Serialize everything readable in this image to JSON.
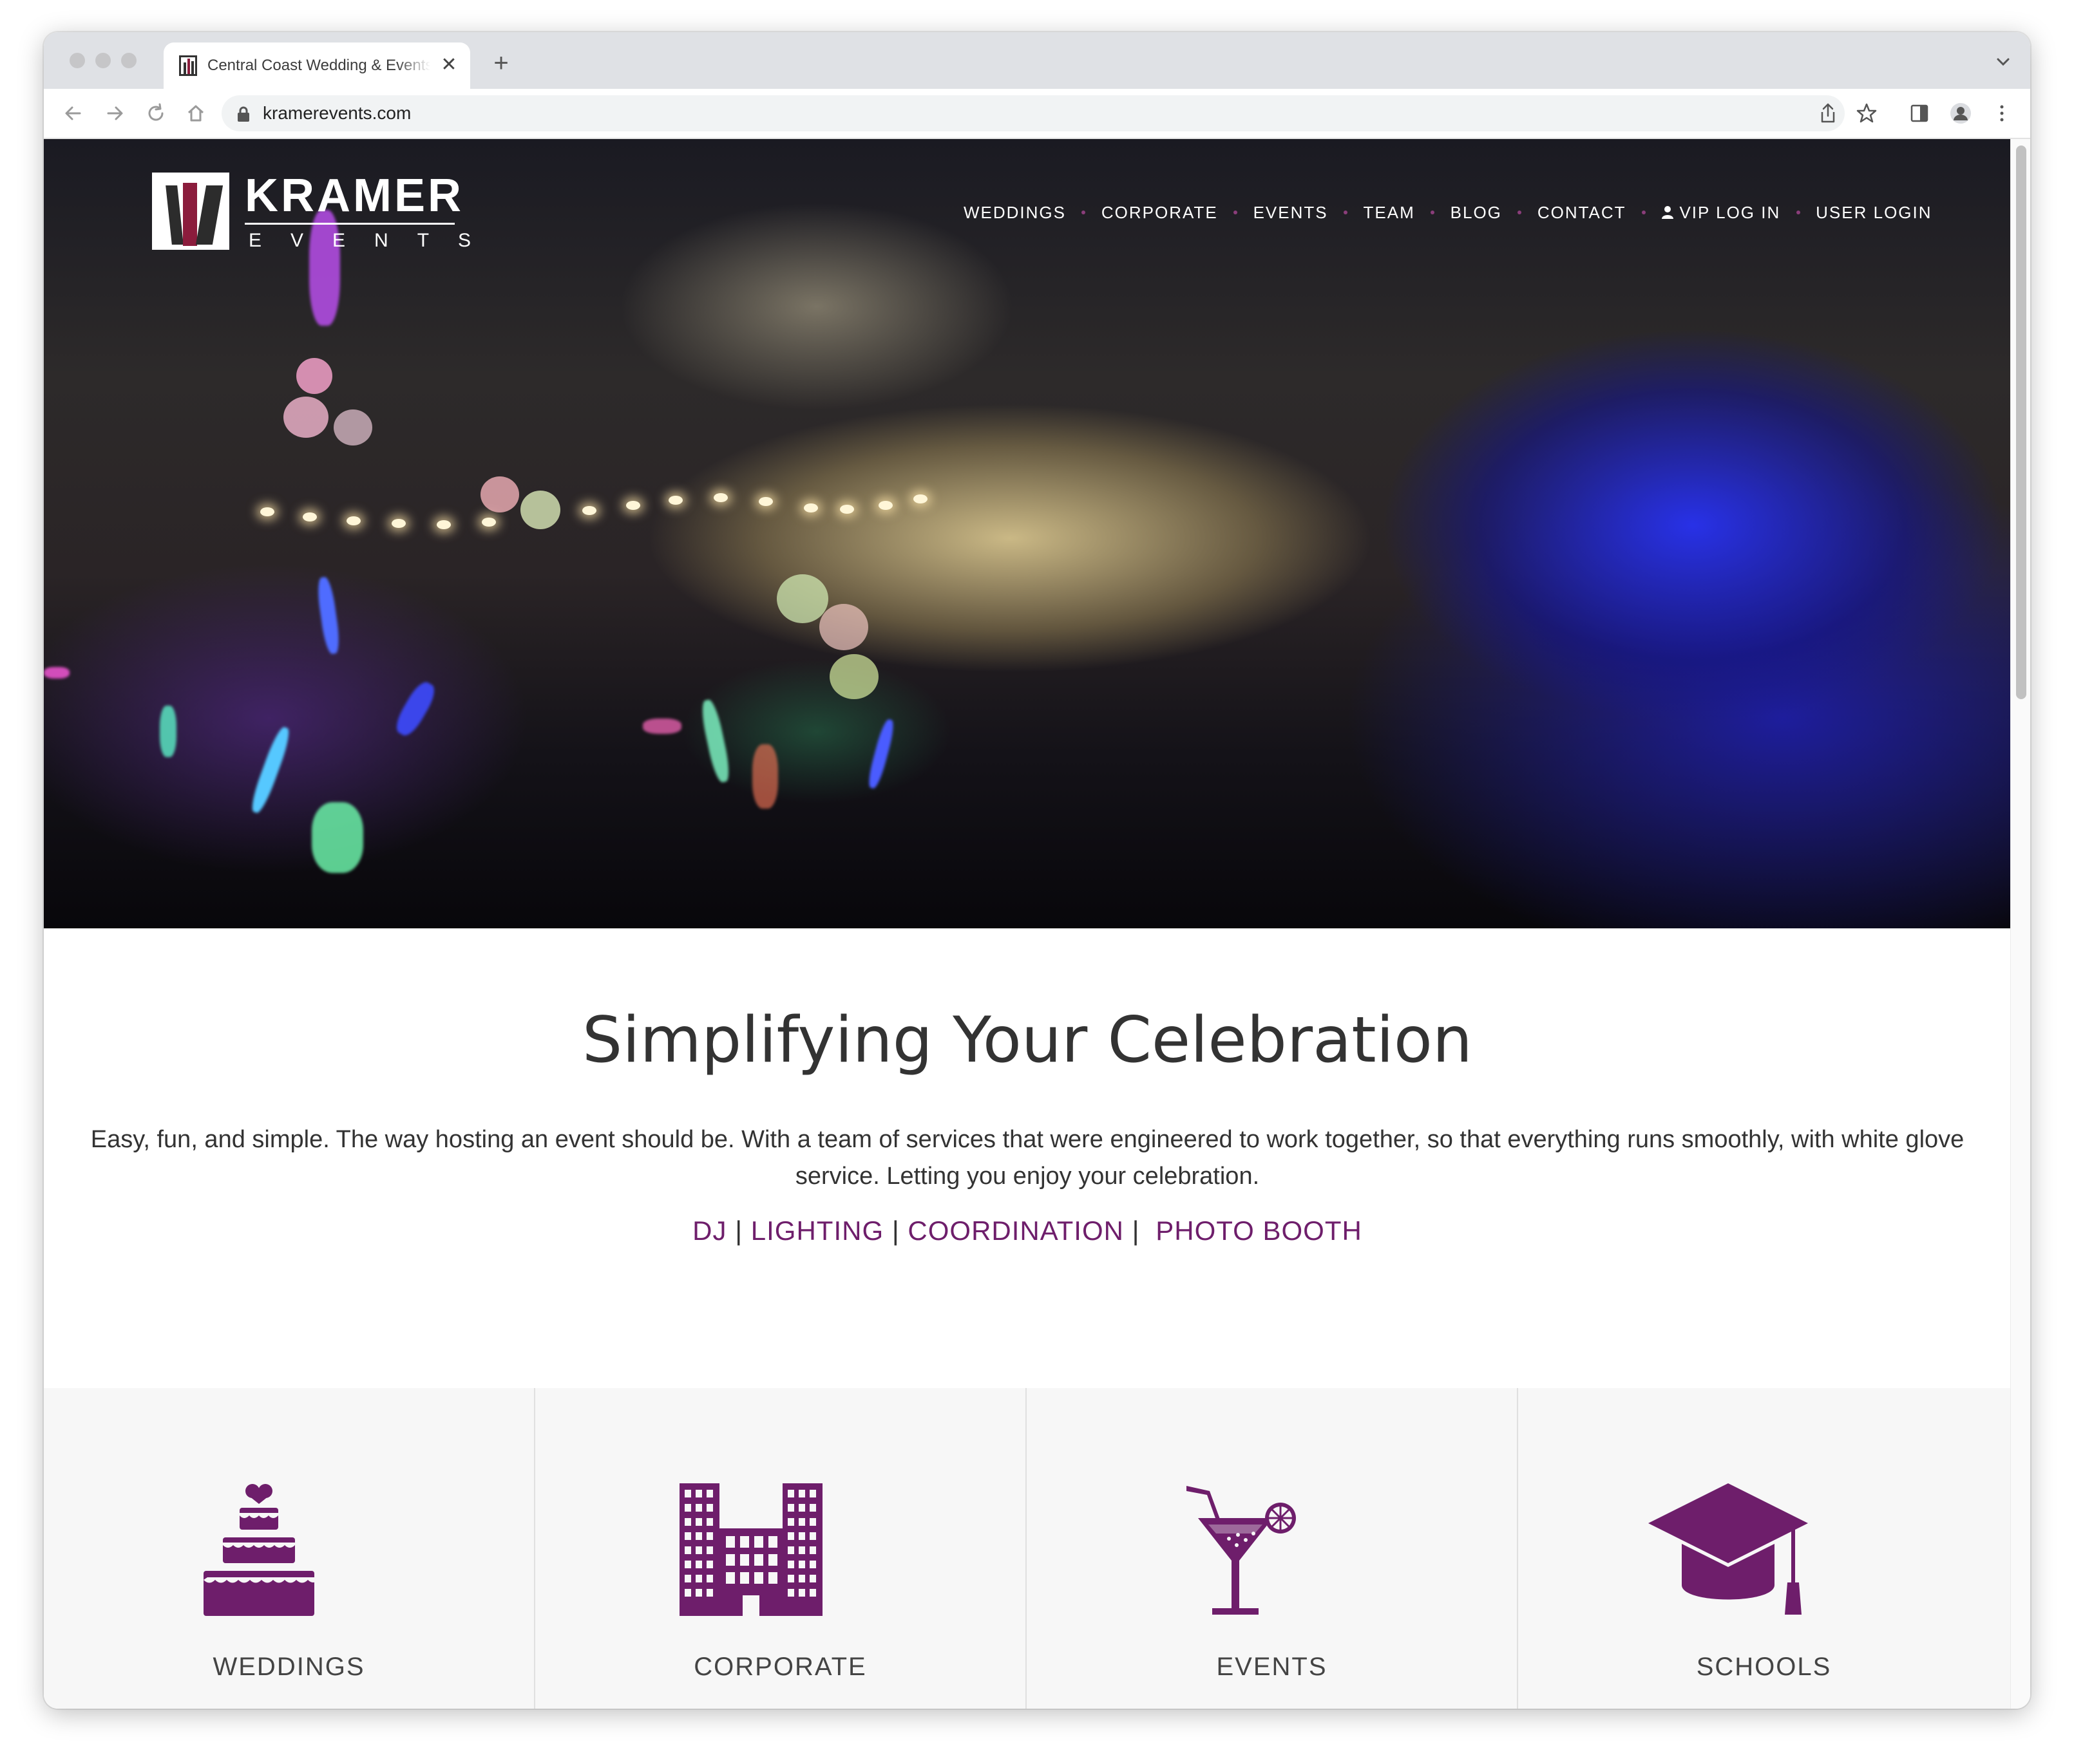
{
  "browser": {
    "tab_title": "Central Coast Wedding & Events",
    "url": "kramerevents.com",
    "new_tab_label": "+",
    "close_label": "✕"
  },
  "site": {
    "logo_name": "KRAMER",
    "logo_sub": "EVENTS",
    "nav": [
      {
        "label": "WEDDINGS"
      },
      {
        "label": "CORPORATE"
      },
      {
        "label": "EVENTS"
      },
      {
        "label": "TEAM"
      },
      {
        "label": "BLOG"
      },
      {
        "label": "CONTACT"
      },
      {
        "label": "VIP LOG IN",
        "icon": "user-icon"
      },
      {
        "label": "USER LOGIN"
      }
    ],
    "headline": "Simplifying Your Celebration",
    "intro": "Easy, fun, and simple. The way hosting an event should be.  With a team of services that were engineered to work together, so that everything runs smoothly, with white glove service.  Letting you enjoy your celebration.",
    "services": [
      "DJ",
      "LIGHTING",
      "COORDINATION",
      "PHOTO BOOTH"
    ],
    "services_separator": "|",
    "cards": [
      {
        "label": "WEDDINGS",
        "icon": "wedding-cake-icon"
      },
      {
        "label": "CORPORATE",
        "icon": "office-buildings-icon"
      },
      {
        "label": "EVENTS",
        "icon": "cocktail-icon"
      },
      {
        "label": "SCHOOLS",
        "icon": "graduation-cap-icon"
      }
    ]
  },
  "colors": {
    "brand_purple": "#6e1e6b",
    "text_dark": "#333333",
    "card_bg": "#f7f7f7"
  }
}
